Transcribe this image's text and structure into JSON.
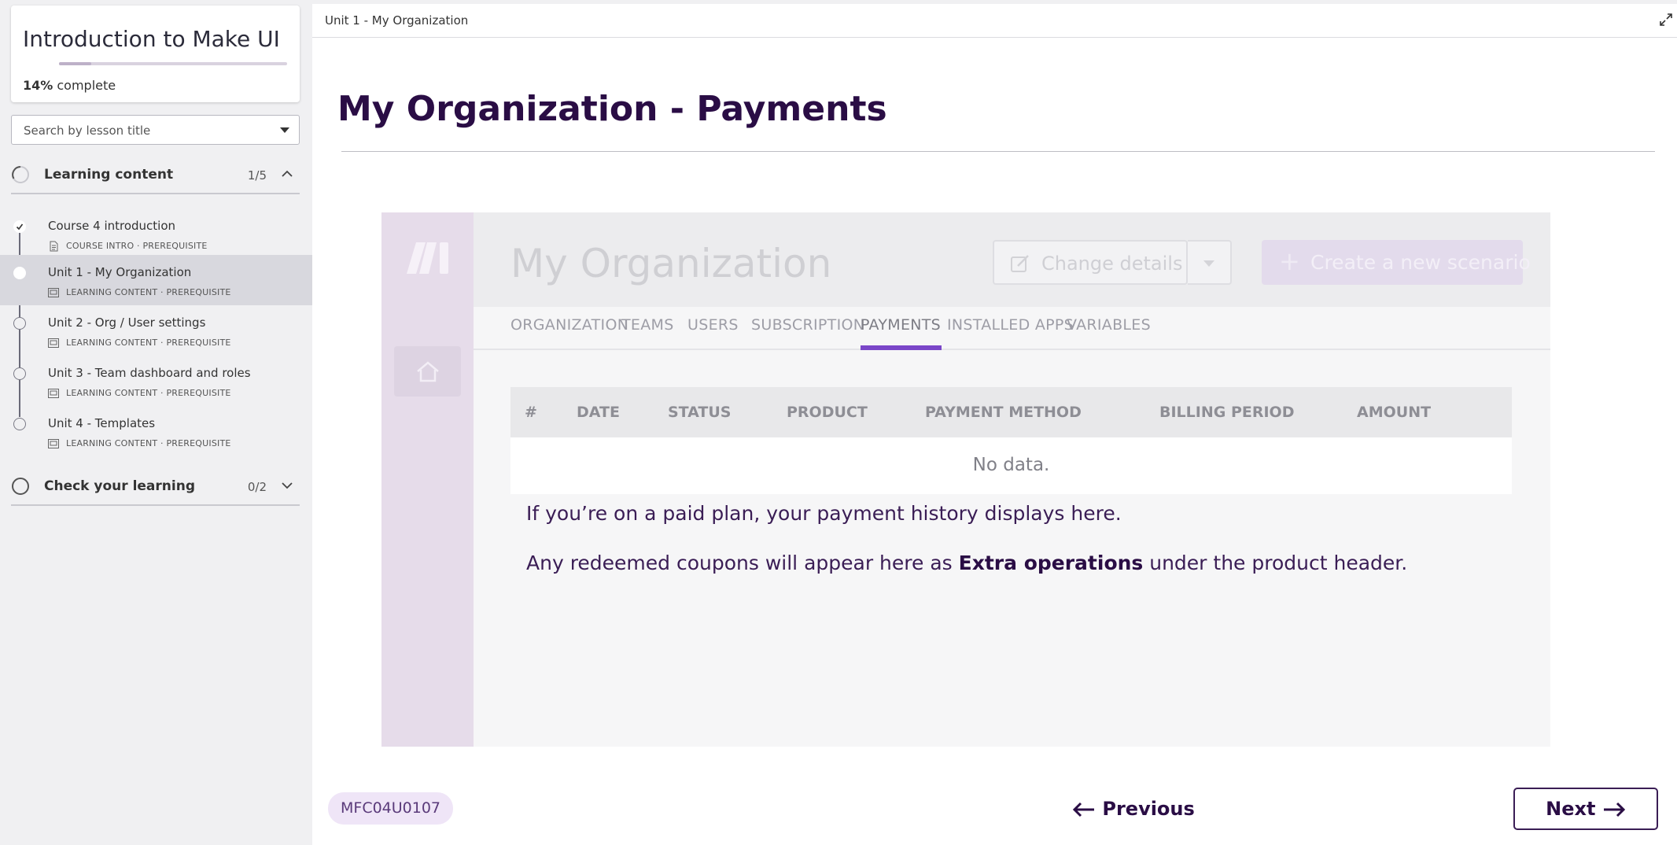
{
  "sidebar": {
    "course_title": "Introduction to Make UI",
    "progress_pct_label": "14%",
    "progress_suffix": " complete",
    "progress_value": 0.14,
    "search_placeholder": "Search by lesson title",
    "sections": [
      {
        "title": "Learning content",
        "count": "1/5",
        "expanded": true
      },
      {
        "title": "Check your learning",
        "count": "0/2",
        "expanded": false
      }
    ],
    "lessons": [
      {
        "title": "Course 4 introduction",
        "meta": "COURSE INTRO · PREREQUISITE",
        "status": "complete",
        "icon": "document-icon"
      },
      {
        "title": "Unit 1 - My Organization",
        "meta": "LEARNING CONTENT · PREREQUISITE",
        "status": "current",
        "icon": "slides-icon"
      },
      {
        "title": "Unit 2 - Org / User settings",
        "meta": "LEARNING CONTENT · PREREQUISITE",
        "status": "todo",
        "icon": "slides-icon"
      },
      {
        "title": "Unit 3 - Team dashboard and roles",
        "meta": "LEARNING CONTENT · PREREQUISITE",
        "status": "todo",
        "icon": "slides-icon"
      },
      {
        "title": "Unit 4 - Templates",
        "meta": "LEARNING CONTENT · PREREQUISITE",
        "status": "todo",
        "icon": "slides-icon"
      }
    ]
  },
  "main": {
    "breadcrumb": "Unit 1 - My Organization",
    "page_title": "My Organization - Payments",
    "app_screenshot": {
      "org_title": "My Organization",
      "change_details": "Change details",
      "create_scenario": "Create a new scenario",
      "tabs": [
        "ORGANIZATION",
        "TEAMS",
        "USERS",
        "SUBSCRIPTION",
        "PAYMENTS",
        "INSTALLED APPS",
        "VARIABLES"
      ],
      "active_tab": "PAYMENTS",
      "columns": [
        "#",
        "DATE",
        "STATUS",
        "PRODUCT",
        "PAYMENT METHOD",
        "BILLING PERIOD",
        "AMOUNT"
      ],
      "empty_text": "No data."
    },
    "overlay": {
      "line1": "If you’re on a paid plan, your payment history displays here.",
      "line2_before": "Any redeemed coupons will appear here as ",
      "line2_bold": "Extra operations",
      "line2_after": " under the product header."
    },
    "footer": {
      "code": "MFC04U0107",
      "previous_label": "Previous",
      "next_label": "Next"
    }
  },
  "colors": {
    "brand_dark": "#2a0d45",
    "accent_purple": "#7a46c8",
    "code_badge_bg": "#efe5f7"
  }
}
